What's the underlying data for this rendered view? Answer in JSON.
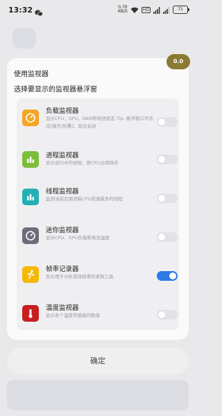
{
  "status_bar": {
    "time": "13:32",
    "speed_value": "0.70",
    "speed_unit": "KB/S",
    "hd_label": "HD",
    "battery": "71"
  },
  "fps_badge": "0.0",
  "dialog": {
    "title": "使用监视器",
    "subtitle": "选择要显示的监视器悬浮窗",
    "items": [
      {
        "name": "负载监视器",
        "desc": "显示CPU、GPU、RAM和电池状态 Tip: 悬浮窗口可点击[展开/折叠]，双击关闭",
        "icon": "gauge-icon",
        "color": "#f5a623",
        "enabled": false
      },
      {
        "name": "进程监视器",
        "desc": "显示运行中的进程，按CPU占用排序",
        "icon": "bar-chart-icon",
        "color": "#7cbd3a",
        "enabled": false
      },
      {
        "name": "线程监视器",
        "desc": "监测当前应用消耗CPU资源最多的线程",
        "icon": "bar-chart-icon",
        "color": "#23b0b4",
        "enabled": false
      },
      {
        "name": "迷你监视器",
        "desc": "显示CPU、GPU负载和电池温度",
        "icon": "gauge-icon",
        "color": "#6b6d78",
        "enabled": false
      },
      {
        "name": "帧率记录器",
        "desc": "显示用于分析游戏帧率的录制工具",
        "icon": "runner-icon",
        "color": "#f5b800",
        "enabled": true
      },
      {
        "name": "温度监视器",
        "desc": "显示各个温度传感器的数值",
        "icon": "thermometer-icon",
        "color": "#c81e1e",
        "enabled": false
      }
    ]
  },
  "confirm_label": "确定",
  "colors": {
    "toggle_on": "#2f7ae5",
    "toggle_off": "#e2e2e6",
    "badge": "#8a7a32"
  }
}
